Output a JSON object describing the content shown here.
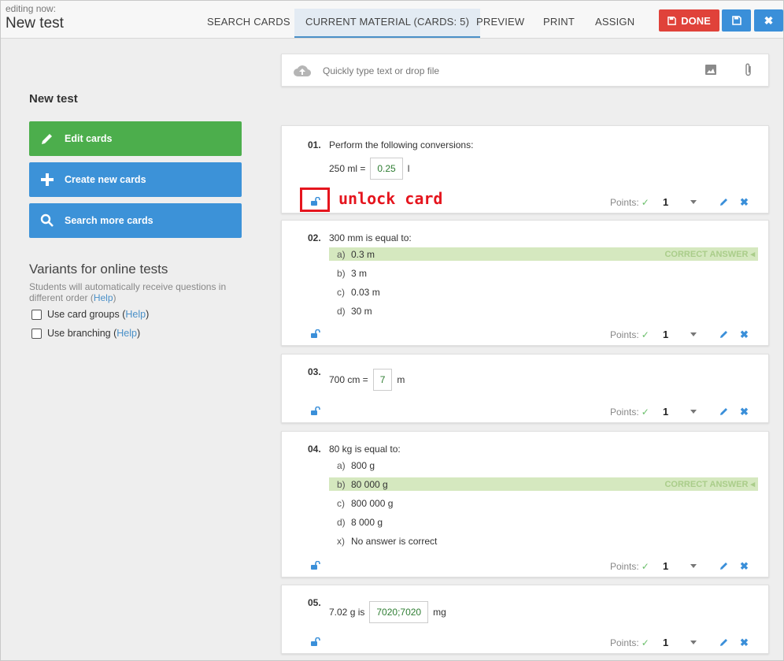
{
  "header": {
    "editing_label": "editing now:",
    "title": "New test",
    "tabs": [
      "SEARCH CARDS",
      "CURRENT MATERIAL (CARDS: 5)",
      "PREVIEW",
      "PRINT",
      "ASSIGN"
    ],
    "active_tab": "CURRENT MATERIAL (CARDS: 5)",
    "done_label": "DONE"
  },
  "left": {
    "title": "New test",
    "edit_cards": "Edit cards",
    "create_cards": "Create new cards",
    "search_cards": "Search more cards",
    "variants_title": "Variants for online tests",
    "variants_desc": "Students will automatically receive questions in different order",
    "help": "Help",
    "use_card_groups": "Use card groups",
    "use_branching": "Use branching"
  },
  "upload": {
    "placeholder": "Quickly type text or drop file"
  },
  "annotation": "unlock card",
  "points_label": "Points:",
  "correct_answer_label": "CORRECT ANSWER",
  "cards": [
    {
      "num": "01.",
      "text": "Perform the following conversions:",
      "pre": "250 ml =",
      "answer": "0.25",
      "post": "l",
      "points": "1"
    },
    {
      "num": "02.",
      "text": "300 mm is equal to:",
      "options": [
        {
          "letter": "a)",
          "text": "0.3 m",
          "correct": true
        },
        {
          "letter": "b)",
          "text": "3 m"
        },
        {
          "letter": "c)",
          "text": "0.03 m"
        },
        {
          "letter": "d)",
          "text": "30 m"
        }
      ],
      "points": "1"
    },
    {
      "num": "03.",
      "pre": "700 cm =",
      "answer": "7",
      "post": "m",
      "points": "1"
    },
    {
      "num": "04.",
      "text": "80 kg is equal to:",
      "options": [
        {
          "letter": "a)",
          "text": "800 g"
        },
        {
          "letter": "b)",
          "text": "80 000 g",
          "correct": true
        },
        {
          "letter": "c)",
          "text": "800 000 g"
        },
        {
          "letter": "d)",
          "text": "8 000 g"
        },
        {
          "letter": "x)",
          "text": "No answer is correct"
        }
      ],
      "points": "1"
    },
    {
      "num": "05.",
      "pre": "7.02 g is",
      "answer": "7020;7020",
      "post": "mg",
      "points": "1"
    }
  ],
  "colors": {
    "done": "#e0423a",
    "primary": "#3c92d8",
    "green": "#4cae4c",
    "correct_bg": "#d5e8bf",
    "annotation": "#e5151e"
  },
  "icons": [
    "save-icon",
    "pencil-icon",
    "plus-icon",
    "search-icon",
    "cloud-upload-icon",
    "image-icon",
    "paperclip-icon",
    "unlock-icon",
    "edit-icon",
    "close-icon"
  ]
}
